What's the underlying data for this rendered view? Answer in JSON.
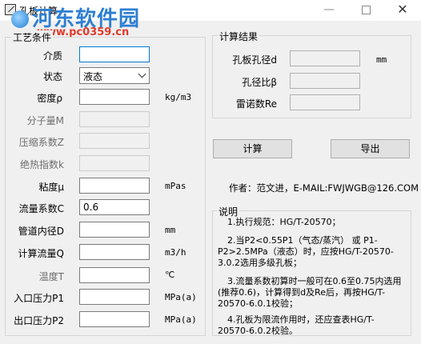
{
  "window": {
    "title": "孔板计算",
    "minimize": "—",
    "close": "✕"
  },
  "watermark": {
    "site": "河东软件园",
    "url": "www.pc0359.cn"
  },
  "process": {
    "group_label": "工艺条件",
    "medium": {
      "label": "介质",
      "value": ""
    },
    "state": {
      "label": "状态",
      "value": "液态"
    },
    "density": {
      "label": "密度ρ",
      "value": "",
      "unit": "kg/m3"
    },
    "molecular_weight": {
      "label": "分子量M",
      "value": ""
    },
    "compress_factor": {
      "label": "压缩系数Z",
      "value": ""
    },
    "adiabatic_index": {
      "label": "绝热指数k",
      "value": ""
    },
    "viscosity": {
      "label": "粘度μ",
      "value": "",
      "unit": "mPas"
    },
    "flow_coeff": {
      "label": "流量系数C",
      "value": "0.6"
    },
    "pipe_diameter": {
      "label": "管道内径D",
      "value": "",
      "unit": "mm"
    },
    "calc_flow": {
      "label": "计算流量Q",
      "value": "",
      "unit": "m3/h"
    },
    "temperature": {
      "label": "温度T",
      "value": "",
      "unit": "℃"
    },
    "inlet_pressure": {
      "label": "入口压力P1",
      "value": "",
      "unit": "MPa(a)"
    },
    "outlet_pressure": {
      "label": "出口压力P2",
      "value": "",
      "unit": "MPa(a)"
    }
  },
  "results": {
    "group_label": "计算结果",
    "orifice_diameter": {
      "label": "孔板孔径d",
      "value": "",
      "unit": "mm"
    },
    "diameter_ratio": {
      "label": "孔径比β",
      "value": ""
    },
    "reynolds": {
      "label": "雷诺数Re",
      "value": ""
    }
  },
  "actions": {
    "calculate": "计算",
    "export": "导出"
  },
  "author": "作者：范文进，E-MAIL:FWJWGB@126.COM",
  "notes": {
    "group_label": "说明",
    "items": [
      "1.执行规范：HG/T-20570；",
      "2.当P2<0.55P1（气态/蒸汽） 或  P1-P2>2.5MPa（液态）时，应按HG/T-20570-3.0.2选用多级孔板；",
      "3.流量系数初算时一般可在0.6至0.75内选用(推荐0.6)，计算得到d及Re后，再按HG/T-20570-6.0.1校验；",
      "4.孔板为限流作用时，还应查表HG/T-20570-6.0.2校验。"
    ]
  }
}
